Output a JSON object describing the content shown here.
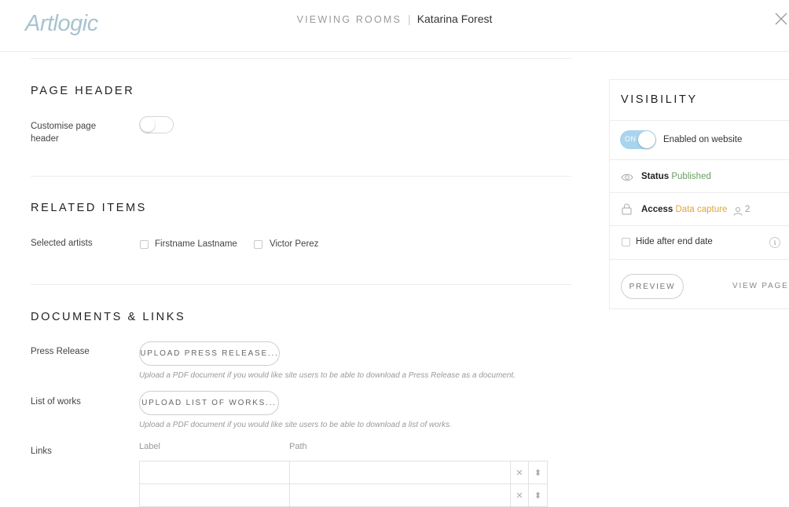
{
  "header": {
    "logo": "Artlogic",
    "section": "VIEWING ROOMS",
    "separator": "|",
    "title": "Katarina Forest",
    "close_icon": "close-icon"
  },
  "page_header": {
    "title": "PAGE HEADER",
    "customise_label_line1": "Customise page",
    "customise_label_line2": "header",
    "customise_enabled": false
  },
  "related_items": {
    "title": "RELATED ITEMS",
    "selected_artists_label": "Selected artists",
    "artists": [
      {
        "name": "Firstname Lastname",
        "checked": false
      },
      {
        "name": "Victor Perez",
        "checked": false
      }
    ]
  },
  "documents": {
    "title": "DOCUMENTS & LINKS",
    "press_release_label": "Press Release",
    "press_release_button": "UPLOAD PRESS RELEASE...",
    "press_release_hint": "Upload a PDF document if you would like site users to be able to download a Press Release as a document.",
    "list_of_works_label": "List of works",
    "list_of_works_button": "UPLOAD LIST OF WORKS...",
    "list_of_works_hint": "Upload a PDF document if you would like site users to be able to download a list of works.",
    "links_label": "Links",
    "links_columns": [
      "Label",
      "Path"
    ],
    "links_rows": [
      {
        "label": "",
        "path": ""
      },
      {
        "label": "",
        "path": ""
      }
    ],
    "remove_glyph": "✕",
    "reorder_glyph": "⬍"
  },
  "visibility": {
    "title": "VISIBILITY",
    "toggle_text": "ON",
    "toggle_on": true,
    "enabled_label": "Enabled on website",
    "status_label": "Status",
    "status_value": "Published",
    "access_label": "Access",
    "access_value": "Data capture",
    "access_count": "2",
    "hide_label": "Hide after end date",
    "info_glyph": "i",
    "preview_button": "PREVIEW",
    "view_page_link": "VIEW PAGE",
    "colors": {
      "published": "#6a9e63",
      "data_capture": "#e0a53a",
      "toggle": "#a9d4ee"
    }
  }
}
